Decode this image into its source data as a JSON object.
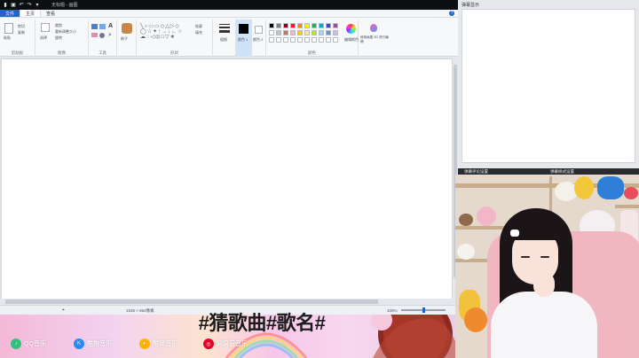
{
  "titlebar": {
    "title": "无标题 - 画图"
  },
  "tabs": {
    "file": "文件",
    "home": "主页",
    "view": "查看"
  },
  "ribbon": {
    "clipboard": {
      "label": "剪贴板",
      "paste": "粘贴",
      "cut": "剪切",
      "copy": "复制"
    },
    "image": {
      "label": "图像",
      "select": "选择",
      "crop": "裁剪",
      "resize": "重新调整大小",
      "rotate": "旋转"
    },
    "tools": {
      "label": "工具"
    },
    "brushes": {
      "label": "刷子"
    },
    "shapes": {
      "label": "形状",
      "outline": "轮廓",
      "fill": "填充"
    },
    "size": {
      "label": "粗细"
    },
    "color1": {
      "label": "颜色 1"
    },
    "color2": {
      "label": "颜色 2"
    },
    "colors": {
      "label": "颜色",
      "edit": "编辑颜色"
    },
    "paint3d": {
      "label": "使用画图 3D 进行编辑"
    }
  },
  "palette": [
    "#000000",
    "#7f7f7f",
    "#880015",
    "#ed1c24",
    "#ff7f27",
    "#fff200",
    "#22b14c",
    "#00a2e8",
    "#3f48cc",
    "#a349a4",
    "#ffffff",
    "#c3c3c3",
    "#b97a57",
    "#ffaec9",
    "#ffc90e",
    "#efe4b0",
    "#b5e61d",
    "#99d9ea",
    "#7092be",
    "#c8bfe7"
  ],
  "statusbar": {
    "dimensions": "1536 × 864像素",
    "zoom": "100%",
    "zoom_value": 0.5
  },
  "chat_panel": {
    "title": "弹幕显示"
  },
  "sub_heads": {
    "left": "弹幕评论设置",
    "right": "弹幕样式设置"
  },
  "banner": {
    "song_title": "#猜歌曲#歌名#",
    "platforms": [
      {
        "name": "QQ音乐",
        "color": "#31c27c"
      },
      {
        "name": "酷狗音乐",
        "color": "#2a8bf2"
      },
      {
        "name": "酷我音乐",
        "color": "#ffb300"
      },
      {
        "name": "网易云音乐",
        "color": "#e60026"
      }
    ]
  }
}
